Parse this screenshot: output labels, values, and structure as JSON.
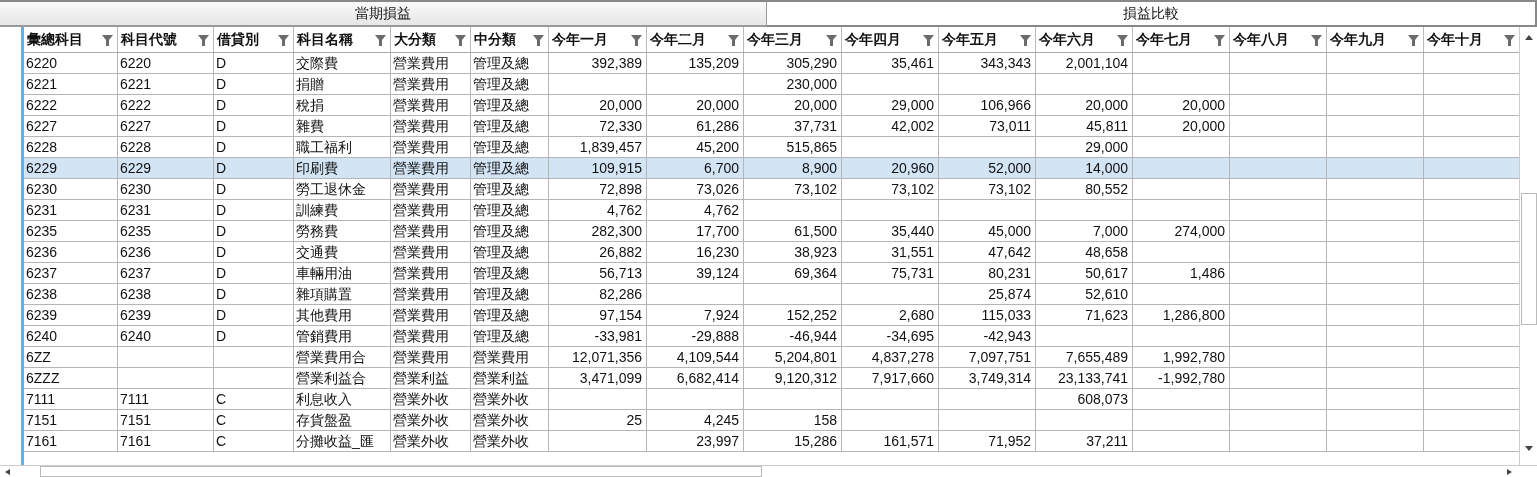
{
  "group_headers": [
    {
      "label": "當期損益"
    },
    {
      "label": "損益比較"
    }
  ],
  "columns": [
    "彙總科目",
    "科目代號",
    "借貸別",
    "科目名稱",
    "大分類",
    "中分類",
    "今年一月",
    "今年二月",
    "今年三月",
    "今年四月",
    "今年五月",
    "今年六月",
    "今年七月",
    "今年八月",
    "今年九月",
    "今年十月"
  ],
  "rows": [
    {
      "selected": false,
      "cells": [
        "6220",
        "6220",
        "D",
        "交際費",
        "營業費用",
        "管理及總",
        "392,389",
        "135,209",
        "305,290",
        "35,461",
        "343,343",
        "2,001,104",
        null,
        null,
        null,
        null
      ]
    },
    {
      "selected": false,
      "cells": [
        "6221",
        "6221",
        "D",
        "捐贈",
        "營業費用",
        "管理及總",
        null,
        null,
        "230,000",
        null,
        null,
        null,
        null,
        null,
        null,
        null
      ]
    },
    {
      "selected": false,
      "cells": [
        "6222",
        "6222",
        "D",
        "稅捐",
        "營業費用",
        "管理及總",
        "20,000",
        "20,000",
        "20,000",
        "29,000",
        "106,966",
        "20,000",
        "20,000",
        null,
        null,
        null
      ]
    },
    {
      "selected": false,
      "cells": [
        "6227",
        "6227",
        "D",
        "雜費",
        "營業費用",
        "管理及總",
        "72,330",
        "61,286",
        "37,731",
        "42,002",
        "73,011",
        "45,811",
        "20,000",
        null,
        null,
        null
      ]
    },
    {
      "selected": false,
      "cells": [
        "6228",
        "6228",
        "D",
        "職工福利",
        "營業費用",
        "管理及總",
        "1,839,457",
        "45,200",
        "515,865",
        null,
        null,
        "29,000",
        null,
        null,
        null,
        null
      ]
    },
    {
      "selected": true,
      "cells": [
        "6229",
        "6229",
        "D",
        "印刷費",
        "營業費用",
        "管理及總",
        "109,915",
        "6,700",
        "8,900",
        "20,960",
        "52,000",
        "14,000",
        null,
        null,
        null,
        null
      ]
    },
    {
      "selected": false,
      "cells": [
        "6230",
        "6230",
        "D",
        "勞工退休金",
        "營業費用",
        "管理及總",
        "72,898",
        "73,026",
        "73,102",
        "73,102",
        "73,102",
        "80,552",
        null,
        null,
        null,
        null
      ]
    },
    {
      "selected": false,
      "cells": [
        "6231",
        "6231",
        "D",
        "訓練費",
        "營業費用",
        "管理及總",
        "4,762",
        "4,762",
        null,
        null,
        null,
        null,
        null,
        null,
        null,
        null
      ]
    },
    {
      "selected": false,
      "cells": [
        "6235",
        "6235",
        "D",
        "勞務費",
        "營業費用",
        "管理及總",
        "282,300",
        "17,700",
        "61,500",
        "35,440",
        "45,000",
        "7,000",
        "274,000",
        null,
        null,
        null
      ]
    },
    {
      "selected": false,
      "cells": [
        "6236",
        "6236",
        "D",
        "交通費",
        "營業費用",
        "管理及總",
        "26,882",
        "16,230",
        "38,923",
        "31,551",
        "47,642",
        "48,658",
        null,
        null,
        null,
        null
      ]
    },
    {
      "selected": false,
      "cells": [
        "6237",
        "6237",
        "D",
        "車輛用油",
        "營業費用",
        "管理及總",
        "56,713",
        "39,124",
        "69,364",
        "75,731",
        "80,231",
        "50,617",
        "1,486",
        null,
        null,
        null
      ]
    },
    {
      "selected": false,
      "cells": [
        "6238",
        "6238",
        "D",
        "雜項購置",
        "營業費用",
        "管理及總",
        "82,286",
        null,
        null,
        null,
        "25,874",
        "52,610",
        null,
        null,
        null,
        null
      ]
    },
    {
      "selected": false,
      "cells": [
        "6239",
        "6239",
        "D",
        "其他費用",
        "營業費用",
        "管理及總",
        "97,154",
        "7,924",
        "152,252",
        "2,680",
        "115,033",
        "71,623",
        "1,286,800",
        null,
        null,
        null
      ]
    },
    {
      "selected": false,
      "cells": [
        "6240",
        "6240",
        "D",
        "管銷費用",
        "營業費用",
        "管理及總",
        "-33,981",
        "-29,888",
        "-46,944",
        "-34,695",
        "-42,943",
        null,
        null,
        null,
        null,
        null
      ]
    },
    {
      "selected": false,
      "cells": [
        "6ZZ",
        null,
        null,
        "營業費用合",
        "營業費用",
        "營業費用",
        "12,071,356",
        "4,109,544",
        "5,204,801",
        "4,837,278",
        "7,097,751",
        "7,655,489",
        "1,992,780",
        null,
        null,
        null
      ]
    },
    {
      "selected": false,
      "cells": [
        "6ZZZ",
        null,
        null,
        "營業利益合",
        "營業利益",
        "營業利益",
        "3,471,099",
        "6,682,414",
        "9,120,312",
        "7,917,660",
        "3,749,314",
        "23,133,741",
        "-1,992,780",
        null,
        null,
        null
      ]
    },
    {
      "selected": false,
      "cells": [
        "7111",
        "7111",
        "C",
        "利息收入",
        "營業外收",
        "營業外收",
        null,
        null,
        null,
        null,
        null,
        "608,073",
        null,
        null,
        null,
        null
      ]
    },
    {
      "selected": false,
      "cells": [
        "7151",
        "7151",
        "C",
        "存貨盤盈",
        "營業外收",
        "營業外收",
        "25",
        "4,245",
        "158",
        null,
        null,
        null,
        null,
        null,
        null,
        null
      ]
    },
    {
      "selected": false,
      "cells": [
        "7161",
        "7161",
        "C",
        "分攤收益_匯",
        "營業外收",
        "營業外收",
        null,
        "23,997",
        "15,286",
        "161,571",
        "71,952",
        "37,211",
        null,
        null,
        null,
        null
      ]
    }
  ]
}
